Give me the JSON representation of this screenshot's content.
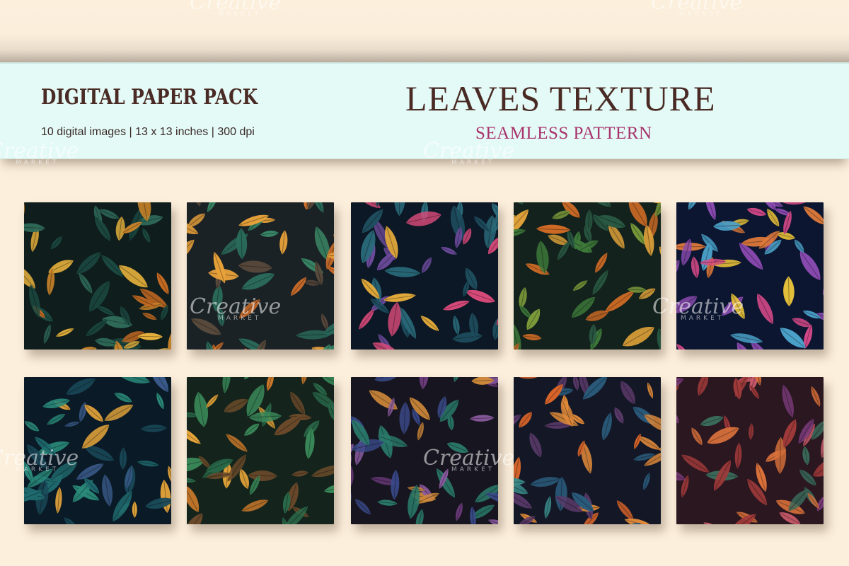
{
  "banner": {
    "left_title": "DIGITAL PAPER PACK",
    "left_subtitle": "10 digital images | 13 x 13 inches | 300 dpi",
    "right_title": "LEAVES TEXTURE",
    "right_subtitle": "SEAMLESS PATTERN"
  },
  "watermark": {
    "brand": "Creative",
    "sub": "MARKET"
  },
  "tiles": [
    {
      "name": "dark green orange leaves",
      "palette": [
        "#0f1d1c",
        "#2f6a58",
        "#d0882a",
        "#e7b23c",
        "#1c4a42",
        "#c46a22"
      ]
    },
    {
      "name": "orange green leaves",
      "palette": [
        "#1b2226",
        "#3a8a68",
        "#d9722a",
        "#e9a23a",
        "#5a4a3c",
        "#2a6a5a"
      ]
    },
    {
      "name": "navy colorful small leaves",
      "palette": [
        "#0c1826",
        "#1e4e5e",
        "#e0a83a",
        "#d84a7a",
        "#2a6a7a",
        "#6a4a9a"
      ]
    },
    {
      "name": "green orange cluster leaves",
      "palette": [
        "#13221c",
        "#3e7a3a",
        "#e0a23a",
        "#cf6b26",
        "#2a5a44",
        "#7a9a3a"
      ]
    },
    {
      "name": "navy multicolor sprigs",
      "palette": [
        "#0c1630",
        "#d84a8a",
        "#e8c23a",
        "#4aa0c8",
        "#8a4ab0",
        "#e07a3a"
      ]
    },
    {
      "name": "teal dark leaves",
      "palette": [
        "#0a1a26",
        "#1f6a6e",
        "#2a8a7a",
        "#e0a23a",
        "#3a5a8a",
        "#1a4a5a"
      ]
    },
    {
      "name": "golden green leaves",
      "palette": [
        "#14241c",
        "#3a8a5a",
        "#e8a63a",
        "#c8782a",
        "#2a6a4a",
        "#6a4a2a"
      ]
    },
    {
      "name": "purple blue dark leaves",
      "palette": [
        "#17151f",
        "#3a4a8a",
        "#6a3a7a",
        "#2a7a6a",
        "#8a5aa0",
        "#d08a3a"
      ]
    },
    {
      "name": "blue orange leaves",
      "palette": [
        "#141826",
        "#2a5a7a",
        "#e08a3a",
        "#3a8a8a",
        "#5a3a6a",
        "#d8642a"
      ]
    },
    {
      "name": "autumn purple red leaves",
      "palette": [
        "#2a1720",
        "#a03a3a",
        "#d8703a",
        "#7a3a7a",
        "#3a6a5a",
        "#c85a6a"
      ]
    }
  ]
}
